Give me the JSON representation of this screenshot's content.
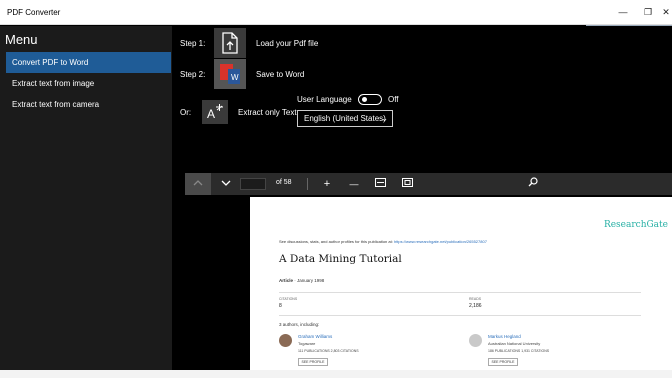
{
  "window": {
    "title": "PDF Converter",
    "minimize": "—",
    "restore": "❐",
    "close": "✕"
  },
  "sidebar": {
    "title": "Menu",
    "items": [
      {
        "label": "Convert PDF to Word"
      },
      {
        "label": "Extract text from image"
      },
      {
        "label": "Extract text from camera"
      }
    ]
  },
  "main": {
    "step1_label": "Step 1:",
    "step1_text": "Load your Pdf file",
    "step2_label": "Step 2:",
    "step2_text": "Save to Word",
    "or_label": "Or:",
    "extract_text": "Extract only Text",
    "user_language_label": "User Language",
    "toggle_state": "Off",
    "language_value": "English (United States)"
  },
  "viewer": {
    "page_of": "of 58",
    "zoom_in": "+",
    "zoom_out": "—"
  },
  "document": {
    "logo": "ResearchGate",
    "link_line_prefix": "See discussions, stats, and author profiles for this publication at:",
    "link_url": "https://www.researchgate.net/publication/2655278​07",
    "title": "A Data Mining Tutorial",
    "meta_type": "Article",
    "meta_date": " · January 1998",
    "citations_label": "CITATIONS",
    "citations_value": "8",
    "reads_label": "READS",
    "reads_value": "2,186",
    "authors_hdr": "3 authors, including:",
    "author1": {
      "name": "Graham Williams",
      "inst": "Togaware",
      "stats": "111 PUBLICATIONS   2,803 CITATIONS",
      "profile": "SEE PROFILE"
    },
    "author2": {
      "name": "Markus Hegland",
      "inst": "Australian National University",
      "stats": "186 PUBLICATIONS   1,931 CITATIONS",
      "profile": "SEE PROFILE"
    }
  }
}
